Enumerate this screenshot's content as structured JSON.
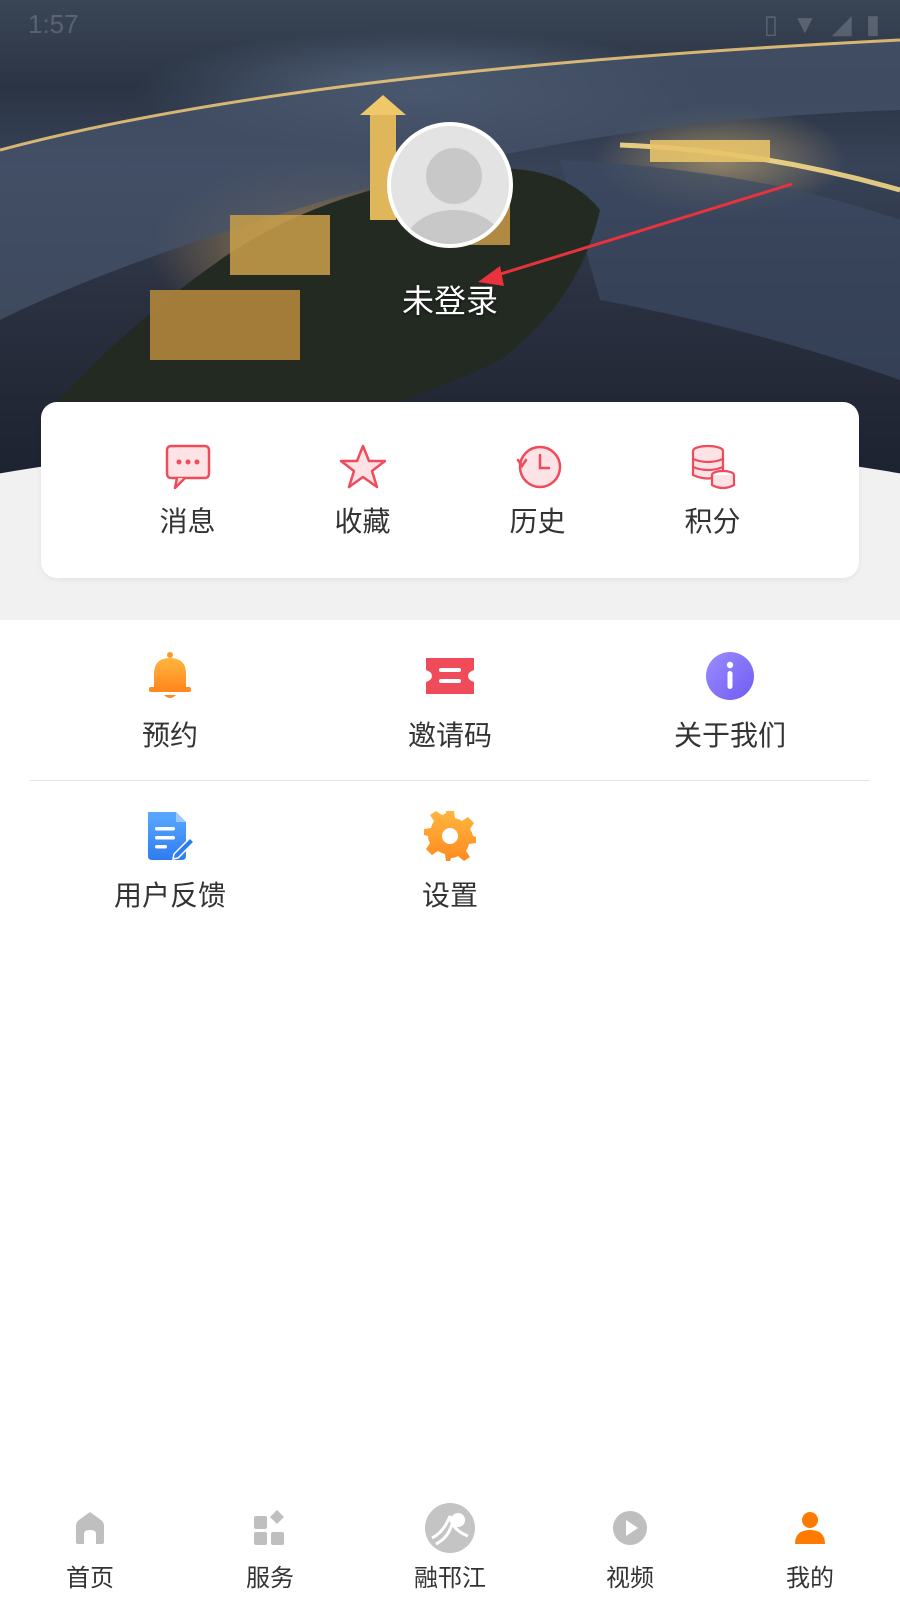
{
  "status_bar": {
    "time": "1:57"
  },
  "profile": {
    "login_status": "未登录"
  },
  "quick_actions": [
    {
      "label": "消息",
      "icon": "message-icon"
    },
    {
      "label": "收藏",
      "icon": "star-icon"
    },
    {
      "label": "历史",
      "icon": "history-icon"
    },
    {
      "label": "积分",
      "icon": "coins-icon"
    }
  ],
  "menu": [
    {
      "label": "预约",
      "icon": "bell-icon"
    },
    {
      "label": "邀请码",
      "icon": "ticket-icon"
    },
    {
      "label": "关于我们",
      "icon": "info-icon"
    },
    {
      "label": "用户反馈",
      "icon": "feedback-icon"
    },
    {
      "label": "设置",
      "icon": "gear-icon"
    }
  ],
  "bottom_nav": [
    {
      "label": "首页",
      "icon": "home-icon"
    },
    {
      "label": "服务",
      "icon": "services-icon"
    },
    {
      "label": "融邗江",
      "icon": "brand-logo-icon"
    },
    {
      "label": "视频",
      "icon": "play-icon"
    },
    {
      "label": "我的",
      "icon": "user-icon",
      "active": true
    }
  ],
  "colors": {
    "accent_red": "#f04b5a",
    "active_orange": "#ff7a00",
    "inactive_gray": "#bfbfbf"
  }
}
